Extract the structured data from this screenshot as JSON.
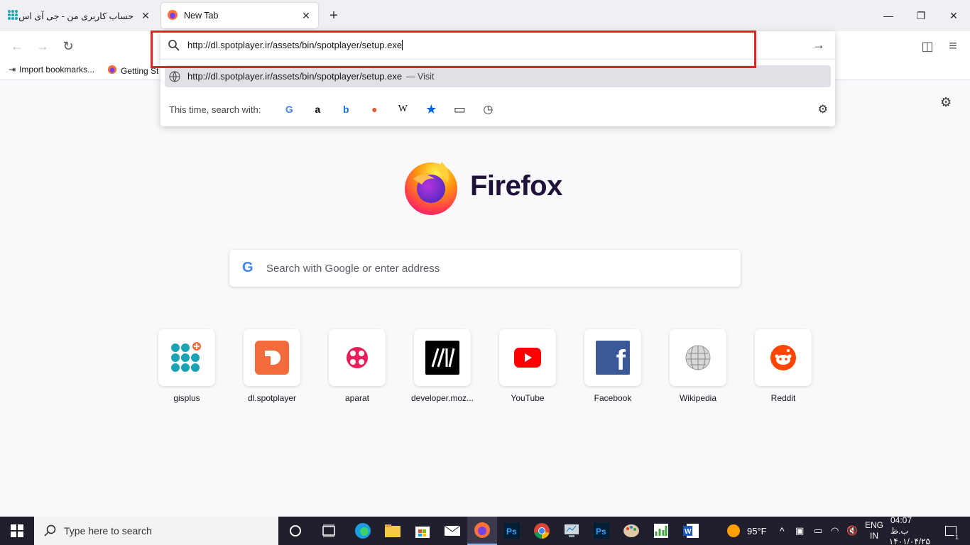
{
  "tabs": [
    {
      "title": "حساب کاربری من - جی آی اس پلاس",
      "close": "✕"
    },
    {
      "title": "New Tab",
      "close": "✕"
    }
  ],
  "window_controls": {
    "minimize": "—",
    "restore": "❐",
    "close": "✕"
  },
  "nav": {
    "back": "←",
    "forward": "→",
    "reload": "↻",
    "pocket": "◫",
    "menu": "≡"
  },
  "bookmarks": [
    {
      "label": "Import bookmarks..."
    },
    {
      "label": "Getting St"
    }
  ],
  "urlbar": {
    "value": "http://dl.spotplayer.ir/assets/bin/spotplayer/setup.exe",
    "go": "→",
    "suggestion": {
      "url": "http://dl.spotplayer.ir/assets/bin/spotplayer/setup.exe",
      "action": "— Visit"
    },
    "search_with_label": "This time, search with:",
    "engines": [
      {
        "name": "google-icon",
        "glyph": "G",
        "color": "#4285f4"
      },
      {
        "name": "amazon-icon",
        "glyph": "a",
        "color": "#000000"
      },
      {
        "name": "bing-icon",
        "glyph": "b",
        "color": "#1a73e8"
      },
      {
        "name": "duckduckgo-icon",
        "glyph": "●",
        "color": "#de5833"
      },
      {
        "name": "wikipedia-icon",
        "glyph": "W",
        "color": "#000000"
      },
      {
        "name": "bookmarks-icon",
        "glyph": "★",
        "color": "#0060df"
      },
      {
        "name": "tabs-icon",
        "glyph": "▭",
        "color": "#333333"
      },
      {
        "name": "history-icon",
        "glyph": "◷",
        "color": "#333333"
      }
    ],
    "settings": "⚙"
  },
  "newtab": {
    "brand": "Firefox",
    "search_placeholder": "Search with Google or enter address",
    "settings": "⚙"
  },
  "top_sites": [
    {
      "name": "gisplus"
    },
    {
      "name": "dl.spotplayer"
    },
    {
      "name": "aparat"
    },
    {
      "name": "developer.moz..."
    },
    {
      "name": "YouTube"
    },
    {
      "name": "Facebook"
    },
    {
      "name": "Wikipedia"
    },
    {
      "name": "Reddit"
    }
  ],
  "taskbar": {
    "search_placeholder": "Type here to search",
    "weather": "95°F",
    "lang": "ENG",
    "region": "IN",
    "time": "04:07 ب.ظ",
    "date": "۱۴۰۱/۰۴/۲۵",
    "notifications": "1"
  }
}
